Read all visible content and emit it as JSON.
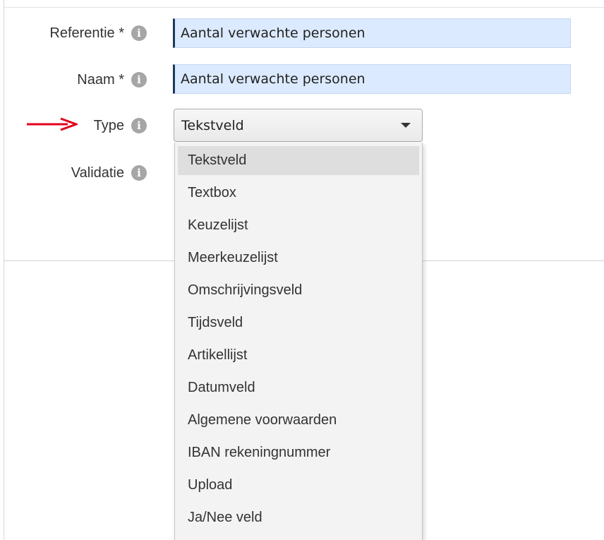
{
  "form": {
    "reference": {
      "label": "Referentie *",
      "value": "Aantal verwachte personen"
    },
    "name": {
      "label": "Naam *",
      "value": "Aantal verwachte personen"
    },
    "type": {
      "label": "Type",
      "selected": "Tekstveld",
      "options": [
        "Tekstveld",
        "Textbox",
        "Keuzelijst",
        "Meerkeuzelijst",
        "Omschrijvingsveld",
        "Tijdsveld",
        "Artikellijst",
        "Datumveld",
        "Algemene voorwaarden",
        "IBAN rekeningnummer",
        "Upload",
        "Ja/Nee veld"
      ]
    },
    "validation": {
      "label": "Validatie"
    }
  },
  "icons": {
    "info": "info-icon",
    "annotation_arrow": "red-arrow-icon",
    "caret": "caret-down-icon"
  },
  "colors": {
    "input_background": "#dbeafe",
    "input_accent_border": "#1f3b5a",
    "arrow": "#e3001b",
    "info_icon": "#a6a6a6",
    "selected_option": "#dedede"
  }
}
